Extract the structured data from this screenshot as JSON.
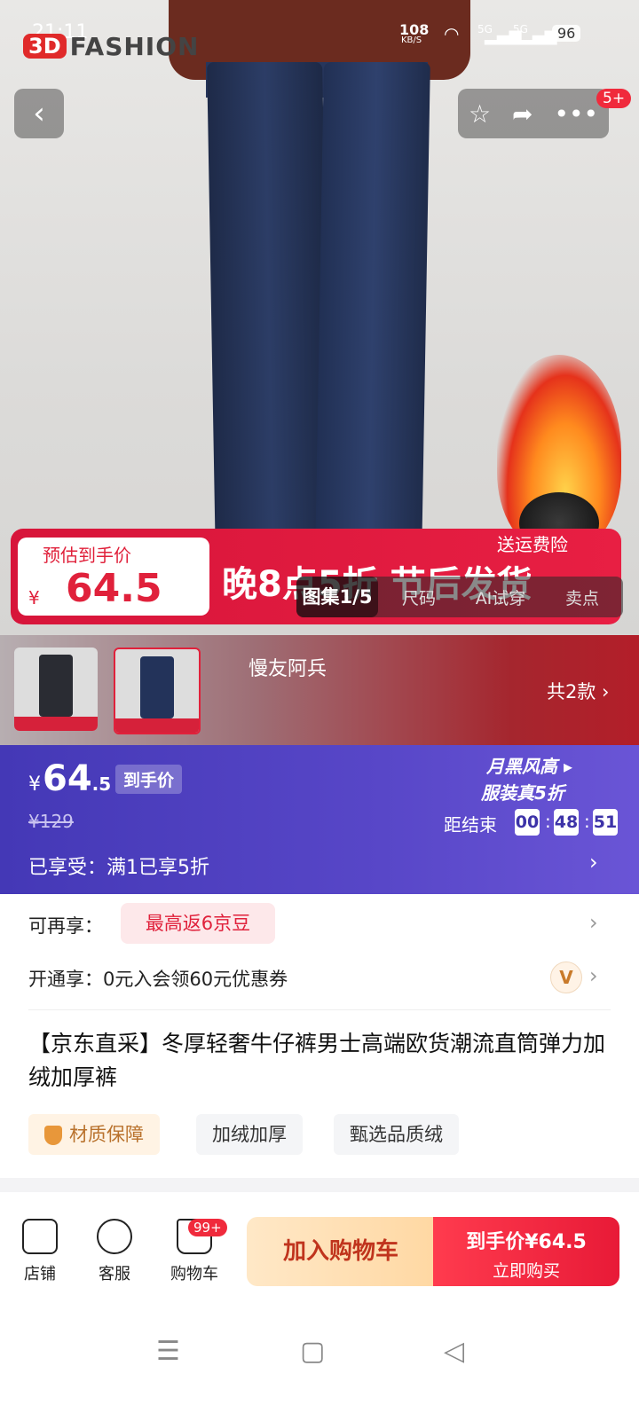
{
  "status_bar": {
    "time": "21:11",
    "net_speed": "108",
    "net_unit": "KB/S",
    "signal1": "5G",
    "signal2": "5G",
    "battery": "96"
  },
  "brand_logo": {
    "badge": "3D",
    "text": "FASHION"
  },
  "header": {
    "back_icon": "chevron-left-icon",
    "badge": "5+"
  },
  "promo": {
    "label": "预估到手价",
    "currency": "¥",
    "price": "64.5",
    "headline": "晚8点5折 节后发货",
    "insurance": "送运费险"
  },
  "gallery_tabs": [
    {
      "label": "图集1/5"
    },
    {
      "label": "尺码"
    },
    {
      "label": "AI试穿"
    },
    {
      "label": "卖点"
    }
  ],
  "variant": {
    "shop_name": "慢友阿兵",
    "count_label": "共2款 ›"
  },
  "price_banner": {
    "currency": "¥",
    "price": "64",
    "price_decimal": ".5",
    "price_tag": "到手价",
    "original_price": "¥129",
    "enjoyed": "已享受：满1已享5折",
    "brand_line1": "月黑风高 ▸",
    "brand_line2": "服装真5折",
    "countdown_label": "距结束",
    "countdown": [
      "00",
      "48",
      "51"
    ]
  },
  "benefits": {
    "row1_label": "可再享：",
    "row1_tag": "最高返6京豆",
    "row2_label": "开通享：0元入会领60元优惠券",
    "vip_mark": "V"
  },
  "product": {
    "title": "【京东直采】冬厚轻奢牛仔裤男士高端欧货潮流直筒弹力加绒加厚裤",
    "features": [
      "材质保障",
      "加绒加厚",
      "甄选品质绒"
    ]
  },
  "bottom_bar": {
    "store": "店铺",
    "service": "客服",
    "cart": "购物车",
    "cart_badge": "99+",
    "add_to_cart": "加入购物车",
    "buy_line1": "到手价¥64.5",
    "buy_line2": "立即购买"
  },
  "colors": {
    "accent_red": "#e0213b",
    "purple": "#4438b6",
    "gold": "#c97a2a"
  }
}
